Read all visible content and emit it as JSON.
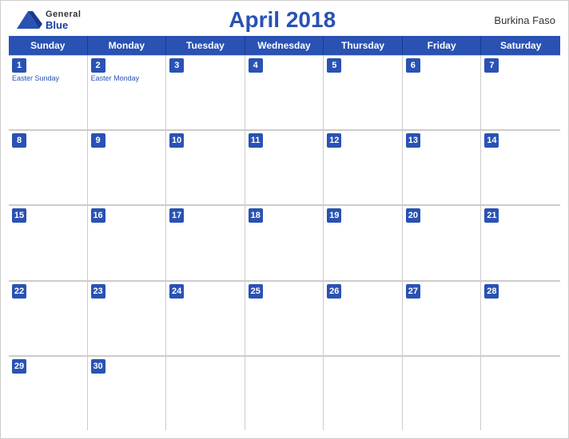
{
  "header": {
    "logo_general": "General",
    "logo_blue": "Blue",
    "title": "April 2018",
    "country": "Burkina Faso"
  },
  "calendar": {
    "weekdays": [
      "Sunday",
      "Monday",
      "Tuesday",
      "Wednesday",
      "Thursday",
      "Friday",
      "Saturday"
    ],
    "weeks": [
      [
        {
          "day": 1,
          "holiday": "Easter Sunday"
        },
        {
          "day": 2,
          "holiday": "Easter Monday"
        },
        {
          "day": 3,
          "holiday": ""
        },
        {
          "day": 4,
          "holiday": ""
        },
        {
          "day": 5,
          "holiday": ""
        },
        {
          "day": 6,
          "holiday": ""
        },
        {
          "day": 7,
          "holiday": ""
        }
      ],
      [
        {
          "day": 8,
          "holiday": ""
        },
        {
          "day": 9,
          "holiday": ""
        },
        {
          "day": 10,
          "holiday": ""
        },
        {
          "day": 11,
          "holiday": ""
        },
        {
          "day": 12,
          "holiday": ""
        },
        {
          "day": 13,
          "holiday": ""
        },
        {
          "day": 14,
          "holiday": ""
        }
      ],
      [
        {
          "day": 15,
          "holiday": ""
        },
        {
          "day": 16,
          "holiday": ""
        },
        {
          "day": 17,
          "holiday": ""
        },
        {
          "day": 18,
          "holiday": ""
        },
        {
          "day": 19,
          "holiday": ""
        },
        {
          "day": 20,
          "holiday": ""
        },
        {
          "day": 21,
          "holiday": ""
        }
      ],
      [
        {
          "day": 22,
          "holiday": ""
        },
        {
          "day": 23,
          "holiday": ""
        },
        {
          "day": 24,
          "holiday": ""
        },
        {
          "day": 25,
          "holiday": ""
        },
        {
          "day": 26,
          "holiday": ""
        },
        {
          "day": 27,
          "holiday": ""
        },
        {
          "day": 28,
          "holiday": ""
        }
      ],
      [
        {
          "day": 29,
          "holiday": ""
        },
        {
          "day": 30,
          "holiday": ""
        },
        {
          "day": null,
          "holiday": ""
        },
        {
          "day": null,
          "holiday": ""
        },
        {
          "day": null,
          "holiday": ""
        },
        {
          "day": null,
          "holiday": ""
        },
        {
          "day": null,
          "holiday": ""
        }
      ]
    ]
  }
}
